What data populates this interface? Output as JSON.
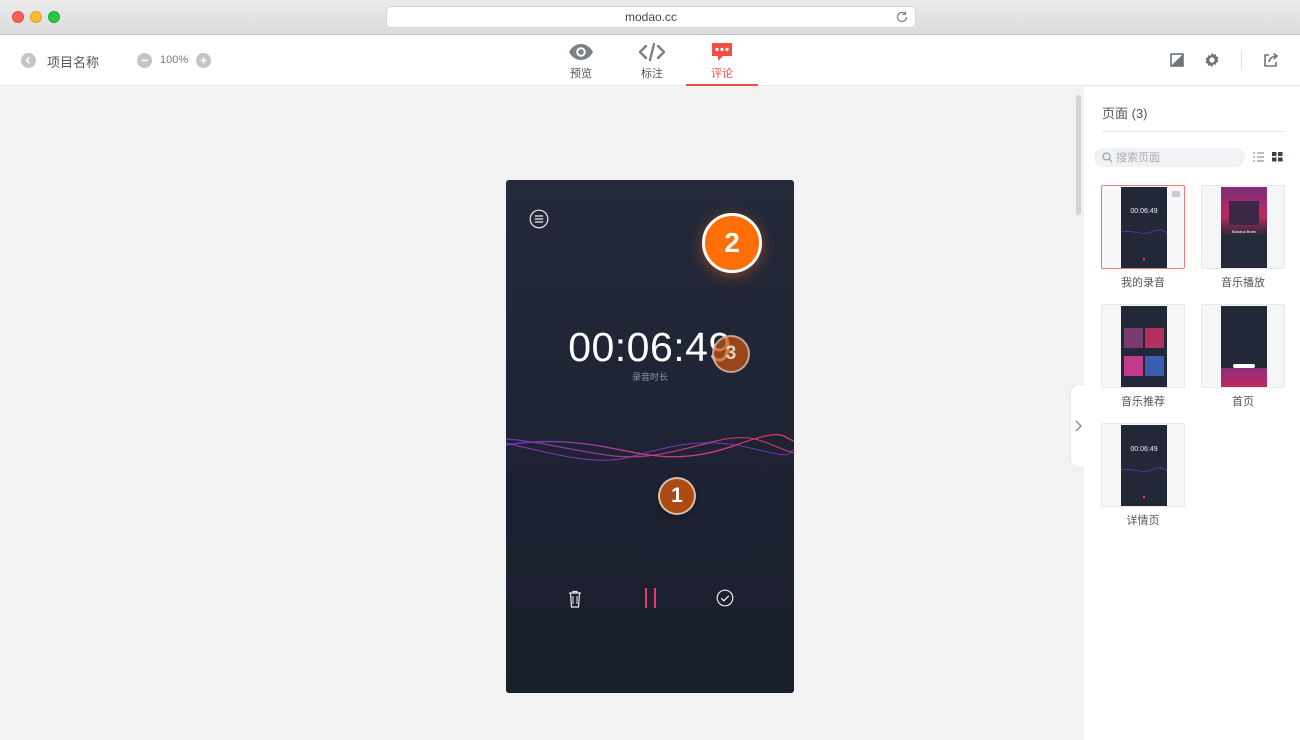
{
  "browser": {
    "url": "modao.cc"
  },
  "toolbar": {
    "project_name": "项目名称",
    "zoom": "100%",
    "tabs": [
      {
        "label": "预览",
        "icon": "eye-icon"
      },
      {
        "label": "标注",
        "icon": "code-icon"
      },
      {
        "label": "评论",
        "icon": "comment-icon",
        "active": true
      }
    ],
    "accent_color": "#f04f43"
  },
  "prototype": {
    "timer": "00:06:49",
    "timer_label": "录音时长",
    "background_color": "#1e2333",
    "markers": [
      {
        "number": "1"
      },
      {
        "number": "2"
      },
      {
        "number": "3"
      }
    ],
    "marker_color": "#ff6e09"
  },
  "panel": {
    "title": "页面 (3)",
    "search_placeholder": "搜索页面",
    "pages": [
      {
        "label": "我的录音",
        "selected": true,
        "thumb_time": "00:06:49"
      },
      {
        "label": "音乐播放",
        "selected": false,
        "thumb_title": "Banana Brain"
      },
      {
        "label": "音乐推荐",
        "selected": false
      },
      {
        "label": "首页",
        "selected": false
      },
      {
        "label": "详情页",
        "selected": false,
        "thumb_time": "00:06:49"
      }
    ]
  }
}
